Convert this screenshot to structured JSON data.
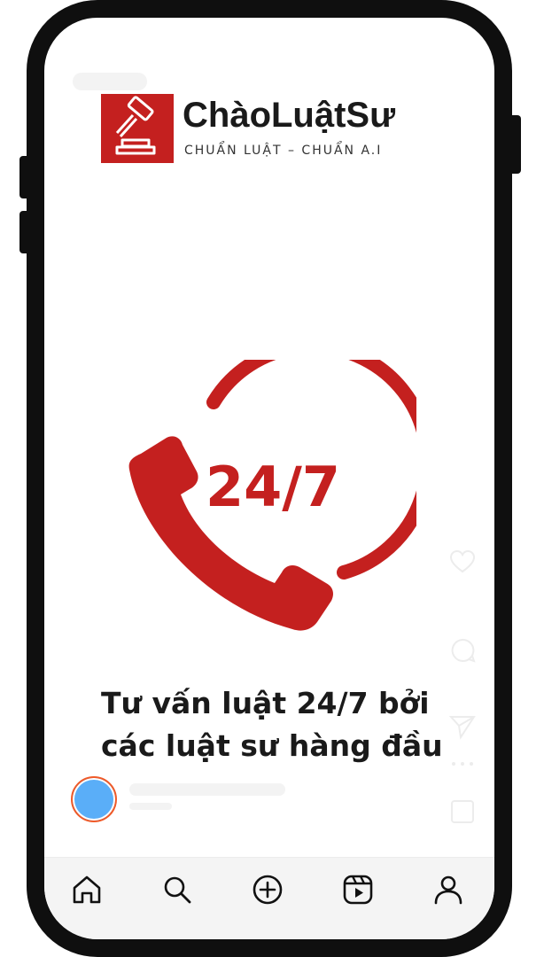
{
  "brand": {
    "name": "ChàoLuậtSư",
    "tagline": "CHUẨN LUẬT – CHUẨN A.I",
    "logo_icon": "gavel-icon",
    "accent_color": "#c4201f"
  },
  "hero": {
    "icon": "phone-24-7-icon",
    "number": "24/7"
  },
  "headline": {
    "line1": "Tư vấn luật 24/7 bởi",
    "line2": "các luật sư hàng đầu"
  },
  "side_actions": [
    "heart-icon",
    "comment-icon",
    "send-icon",
    "more-icon",
    "bookmark-icon"
  ],
  "tabbar": [
    "home-icon",
    "search-icon",
    "add-icon",
    "reels-icon",
    "profile-icon"
  ],
  "colors": {
    "frame": "#0f0f0f",
    "avatar": "#5aaef8",
    "avatar_ring": "#f05a28",
    "tabbar_bg": "#f4f4f4"
  }
}
